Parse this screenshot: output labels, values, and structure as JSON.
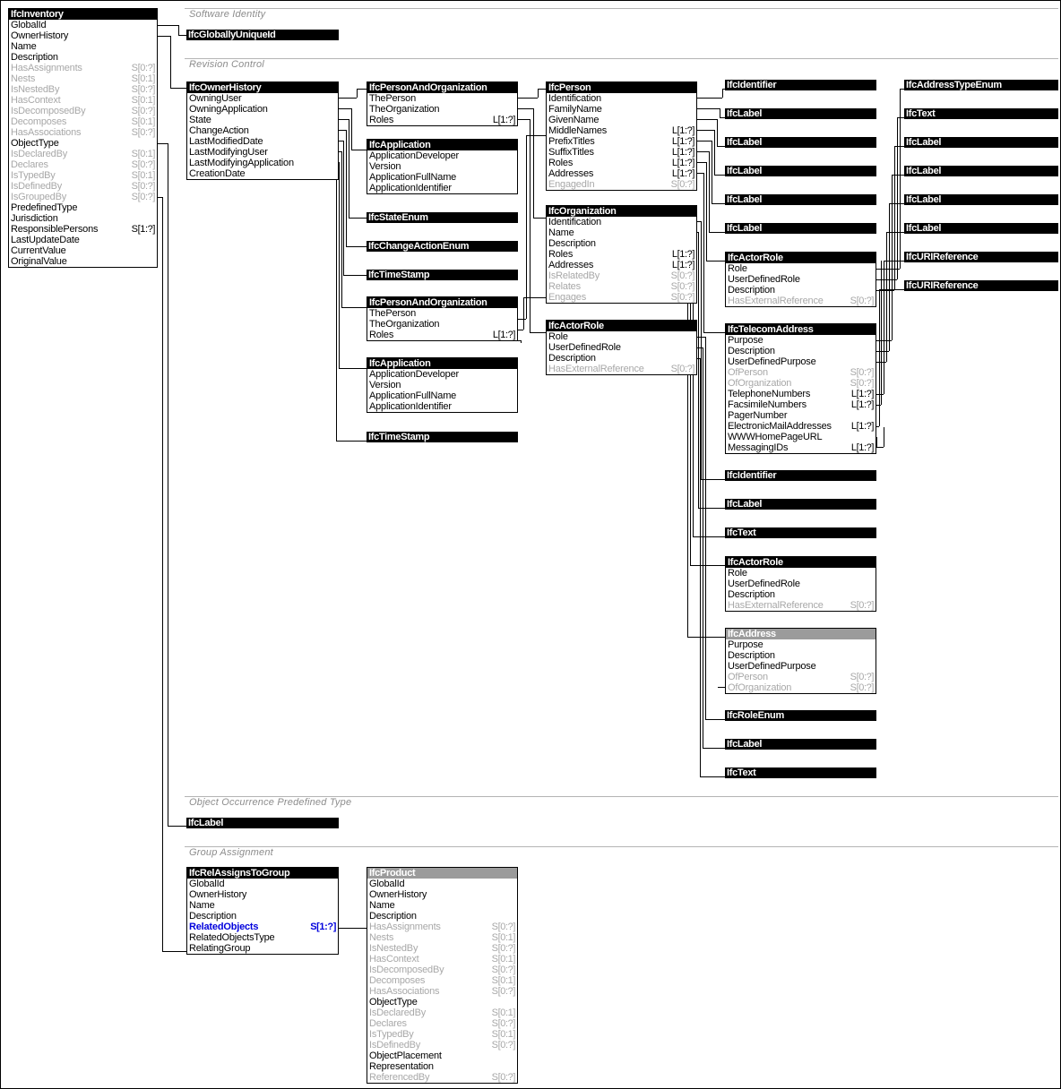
{
  "diagram": {
    "title": "IfcInventory entity relationship diagram",
    "sections": [
      {
        "id": "software-identity",
        "label": "Software Identity"
      },
      {
        "id": "revision-control",
        "label": "Revision Control"
      },
      {
        "id": "object-occurrence-predefined-type",
        "label": "Object Occurrence Predefined Type"
      },
      {
        "id": "group-assignment",
        "label": "Group Assignment"
      }
    ],
    "colors": {
      "header_concrete": "#000000",
      "header_abstract": "#9b9b9b",
      "attribute_text": "#000000",
      "inverse_text": "#a8a8a8",
      "highlight_text": "#0000dd",
      "section_text": "#8c8c8c",
      "canvas": "#ffffff"
    }
  },
  "entities": {
    "ifc_inventory": {
      "name": "IfcInventory",
      "abstract": false,
      "attributes": [
        {
          "name": "GlobalId",
          "card": "",
          "kind": "direct"
        },
        {
          "name": "OwnerHistory",
          "card": "",
          "kind": "direct"
        },
        {
          "name": "Name",
          "card": "",
          "kind": "direct"
        },
        {
          "name": "Description",
          "card": "",
          "kind": "direct"
        },
        {
          "name": "HasAssignments",
          "card": "S[0:?]",
          "kind": "inverse"
        },
        {
          "name": "Nests",
          "card": "S[0:1]",
          "kind": "inverse"
        },
        {
          "name": "IsNestedBy",
          "card": "S[0:?]",
          "kind": "inverse"
        },
        {
          "name": "HasContext",
          "card": "S[0:1]",
          "kind": "inverse"
        },
        {
          "name": "IsDecomposedBy",
          "card": "S[0:?]",
          "kind": "inverse"
        },
        {
          "name": "Decomposes",
          "card": "S[0:1]",
          "kind": "inverse"
        },
        {
          "name": "HasAssociations",
          "card": "S[0:?]",
          "kind": "inverse"
        },
        {
          "name": "ObjectType",
          "card": "",
          "kind": "direct"
        },
        {
          "name": "IsDeclaredBy",
          "card": "S[0:1]",
          "kind": "inverse"
        },
        {
          "name": "Declares",
          "card": "S[0:?]",
          "kind": "inverse"
        },
        {
          "name": "IsTypedBy",
          "card": "S[0:1]",
          "kind": "inverse"
        },
        {
          "name": "IsDefinedBy",
          "card": "S[0:?]",
          "kind": "inverse"
        },
        {
          "name": "IsGroupedBy",
          "card": "S[0:?]",
          "kind": "inverse"
        },
        {
          "name": "PredefinedType",
          "card": "",
          "kind": "direct"
        },
        {
          "name": "Jurisdiction",
          "card": "",
          "kind": "direct"
        },
        {
          "name": "ResponsiblePersons",
          "card": "S[1:?]",
          "kind": "direct"
        },
        {
          "name": "LastUpdateDate",
          "card": "",
          "kind": "direct"
        },
        {
          "name": "CurrentValue",
          "card": "",
          "kind": "direct"
        },
        {
          "name": "OriginalValue",
          "card": "",
          "kind": "direct"
        }
      ]
    },
    "ifc_owner_history": {
      "name": "IfcOwnerHistory",
      "abstract": false,
      "attributes": [
        {
          "name": "OwningUser",
          "card": "",
          "kind": "direct"
        },
        {
          "name": "OwningApplication",
          "card": "",
          "kind": "direct"
        },
        {
          "name": "State",
          "card": "",
          "kind": "direct"
        },
        {
          "name": "ChangeAction",
          "card": "",
          "kind": "direct"
        },
        {
          "name": "LastModifiedDate",
          "card": "",
          "kind": "direct"
        },
        {
          "name": "LastModifyingUser",
          "card": "",
          "kind": "direct"
        },
        {
          "name": "LastModifyingApplication",
          "card": "",
          "kind": "direct"
        },
        {
          "name": "CreationDate",
          "card": "",
          "kind": "direct"
        }
      ]
    },
    "ifc_person_and_organization_1": {
      "name": "IfcPersonAndOrganization",
      "abstract": false,
      "attributes": [
        {
          "name": "ThePerson",
          "card": "",
          "kind": "direct"
        },
        {
          "name": "TheOrganization",
          "card": "",
          "kind": "direct"
        },
        {
          "name": "Roles",
          "card": "L[1:?]",
          "kind": "direct"
        }
      ]
    },
    "ifc_application_1": {
      "name": "IfcApplication",
      "abstract": false,
      "attributes": [
        {
          "name": "ApplicationDeveloper",
          "card": "",
          "kind": "direct"
        },
        {
          "name": "Version",
          "card": "",
          "kind": "direct"
        },
        {
          "name": "ApplicationFullName",
          "card": "",
          "kind": "direct"
        },
        {
          "name": "ApplicationIdentifier",
          "card": "",
          "kind": "direct"
        }
      ]
    },
    "ifc_person_and_organization_2": {
      "name": "IfcPersonAndOrganization",
      "abstract": false,
      "attributes": [
        {
          "name": "ThePerson",
          "card": "",
          "kind": "direct"
        },
        {
          "name": "TheOrganization",
          "card": "",
          "kind": "direct"
        },
        {
          "name": "Roles",
          "card": "L[1:?]",
          "kind": "direct"
        }
      ]
    },
    "ifc_application_2": {
      "name": "IfcApplication",
      "abstract": false,
      "attributes": [
        {
          "name": "ApplicationDeveloper",
          "card": "",
          "kind": "direct"
        },
        {
          "name": "Version",
          "card": "",
          "kind": "direct"
        },
        {
          "name": "ApplicationFullName",
          "card": "",
          "kind": "direct"
        },
        {
          "name": "ApplicationIdentifier",
          "card": "",
          "kind": "direct"
        }
      ]
    },
    "ifc_person": {
      "name": "IfcPerson",
      "abstract": false,
      "attributes": [
        {
          "name": "Identification",
          "card": "",
          "kind": "direct"
        },
        {
          "name": "FamilyName",
          "card": "",
          "kind": "direct"
        },
        {
          "name": "GivenName",
          "card": "",
          "kind": "direct"
        },
        {
          "name": "MiddleNames",
          "card": "L[1:?]",
          "kind": "direct"
        },
        {
          "name": "PrefixTitles",
          "card": "L[1:?]",
          "kind": "direct"
        },
        {
          "name": "SuffixTitles",
          "card": "L[1:?]",
          "kind": "direct"
        },
        {
          "name": "Roles",
          "card": "L[1:?]",
          "kind": "direct"
        },
        {
          "name": "Addresses",
          "card": "L[1:?]",
          "kind": "direct"
        },
        {
          "name": "EngagedIn",
          "card": "S[0:?]",
          "kind": "inverse"
        }
      ]
    },
    "ifc_organization": {
      "name": "IfcOrganization",
      "abstract": false,
      "attributes": [
        {
          "name": "Identification",
          "card": "",
          "kind": "direct"
        },
        {
          "name": "Name",
          "card": "",
          "kind": "direct"
        },
        {
          "name": "Description",
          "card": "",
          "kind": "direct"
        },
        {
          "name": "Roles",
          "card": "L[1:?]",
          "kind": "direct"
        },
        {
          "name": "Addresses",
          "card": "L[1:?]",
          "kind": "direct"
        },
        {
          "name": "IsRelatedBy",
          "card": "S[0:?]",
          "kind": "inverse"
        },
        {
          "name": "Relates",
          "card": "S[0:?]",
          "kind": "inverse"
        },
        {
          "name": "Engages",
          "card": "S[0:?]",
          "kind": "inverse"
        }
      ]
    },
    "ifc_actor_role_mid": {
      "name": "IfcActorRole",
      "abstract": false,
      "attributes": [
        {
          "name": "Role",
          "card": "",
          "kind": "direct"
        },
        {
          "name": "UserDefinedRole",
          "card": "",
          "kind": "direct"
        },
        {
          "name": "Description",
          "card": "",
          "kind": "direct"
        },
        {
          "name": "HasExternalReference",
          "card": "S[0:?]",
          "kind": "inverse"
        }
      ]
    },
    "ifc_actor_role_r1": {
      "name": "IfcActorRole",
      "abstract": false,
      "attributes": [
        {
          "name": "Role",
          "card": "",
          "kind": "direct"
        },
        {
          "name": "UserDefinedRole",
          "card": "",
          "kind": "direct"
        },
        {
          "name": "Description",
          "card": "",
          "kind": "direct"
        },
        {
          "name": "HasExternalReference",
          "card": "S[0:?]",
          "kind": "inverse"
        }
      ]
    },
    "ifc_telecom_address": {
      "name": "IfcTelecomAddress",
      "abstract": false,
      "attributes": [
        {
          "name": "Purpose",
          "card": "",
          "kind": "direct"
        },
        {
          "name": "Description",
          "card": "",
          "kind": "direct"
        },
        {
          "name": "UserDefinedPurpose",
          "card": "",
          "kind": "direct"
        },
        {
          "name": "OfPerson",
          "card": "S[0:?]",
          "kind": "inverse"
        },
        {
          "name": "OfOrganization",
          "card": "S[0:?]",
          "kind": "inverse"
        },
        {
          "name": "TelephoneNumbers",
          "card": "L[1:?]",
          "kind": "direct"
        },
        {
          "name": "FacsimileNumbers",
          "card": "L[1:?]",
          "kind": "direct"
        },
        {
          "name": "PagerNumber",
          "card": "",
          "kind": "direct"
        },
        {
          "name": "ElectronicMailAddresses",
          "card": "L[1:?]",
          "kind": "direct"
        },
        {
          "name": "WWWHomePageURL",
          "card": "",
          "kind": "direct"
        },
        {
          "name": "MessagingIDs",
          "card": "L[1:?]",
          "kind": "direct"
        }
      ]
    },
    "ifc_actor_role_r2": {
      "name": "IfcActorRole",
      "abstract": false,
      "attributes": [
        {
          "name": "Role",
          "card": "",
          "kind": "direct"
        },
        {
          "name": "UserDefinedRole",
          "card": "",
          "kind": "direct"
        },
        {
          "name": "Description",
          "card": "",
          "kind": "direct"
        },
        {
          "name": "HasExternalReference",
          "card": "S[0:?]",
          "kind": "inverse"
        }
      ]
    },
    "ifc_address": {
      "name": "IfcAddress",
      "abstract": true,
      "attributes": [
        {
          "name": "Purpose",
          "card": "",
          "kind": "direct"
        },
        {
          "name": "Description",
          "card": "",
          "kind": "direct"
        },
        {
          "name": "UserDefinedPurpose",
          "card": "",
          "kind": "direct"
        },
        {
          "name": "OfPerson",
          "card": "S[0:?]",
          "kind": "inverse"
        },
        {
          "name": "OfOrganization",
          "card": "S[0:?]",
          "kind": "inverse"
        }
      ]
    },
    "ifc_rel_assigns_to_group": {
      "name": "IfcRelAssignsToGroup",
      "abstract": false,
      "attributes": [
        {
          "name": "GlobalId",
          "card": "",
          "kind": "direct"
        },
        {
          "name": "OwnerHistory",
          "card": "",
          "kind": "direct"
        },
        {
          "name": "Name",
          "card": "",
          "kind": "direct"
        },
        {
          "name": "Description",
          "card": "",
          "kind": "direct"
        },
        {
          "name": "RelatedObjects",
          "card": "S[1:?]",
          "kind": "highlight"
        },
        {
          "name": "RelatedObjectsType",
          "card": "",
          "kind": "direct"
        },
        {
          "name": "RelatingGroup",
          "card": "",
          "kind": "direct"
        }
      ]
    },
    "ifc_product": {
      "name": "IfcProduct",
      "abstract": true,
      "attributes": [
        {
          "name": "GlobalId",
          "card": "",
          "kind": "direct"
        },
        {
          "name": "OwnerHistory",
          "card": "",
          "kind": "direct"
        },
        {
          "name": "Name",
          "card": "",
          "kind": "direct"
        },
        {
          "name": "Description",
          "card": "",
          "kind": "direct"
        },
        {
          "name": "HasAssignments",
          "card": "S[0:?]",
          "kind": "inverse"
        },
        {
          "name": "Nests",
          "card": "S[0:1]",
          "kind": "inverse"
        },
        {
          "name": "IsNestedBy",
          "card": "S[0:?]",
          "kind": "inverse"
        },
        {
          "name": "HasContext",
          "card": "S[0:1]",
          "kind": "inverse"
        },
        {
          "name": "IsDecomposedBy",
          "card": "S[0:?]",
          "kind": "inverse"
        },
        {
          "name": "Decomposes",
          "card": "S[0:1]",
          "kind": "inverse"
        },
        {
          "name": "HasAssociations",
          "card": "S[0:?]",
          "kind": "inverse"
        },
        {
          "name": "ObjectType",
          "card": "",
          "kind": "direct"
        },
        {
          "name": "IsDeclaredBy",
          "card": "S[0:1]",
          "kind": "inverse"
        },
        {
          "name": "Declares",
          "card": "S[0:?]",
          "kind": "inverse"
        },
        {
          "name": "IsTypedBy",
          "card": "S[0:1]",
          "kind": "inverse"
        },
        {
          "name": "IsDefinedBy",
          "card": "S[0:?]",
          "kind": "inverse"
        },
        {
          "name": "ObjectPlacement",
          "card": "",
          "kind": "direct"
        },
        {
          "name": "Representation",
          "card": "",
          "kind": "direct"
        },
        {
          "name": "ReferencedBy",
          "card": "S[0:?]",
          "kind": "inverse"
        }
      ]
    }
  },
  "types": {
    "t_guid": {
      "name": "IfcGloballyUniqueId"
    },
    "t_state_enum": {
      "name": "IfcStateEnum"
    },
    "t_change_enum": {
      "name": "IfcChangeActionEnum"
    },
    "t_timestamp_1": {
      "name": "IfcTimeStamp"
    },
    "t_timestamp_2": {
      "name": "IfcTimeStamp"
    },
    "t_identifier_1": {
      "name": "IfcIdentifier"
    },
    "t_label_1": {
      "name": "IfcLabel"
    },
    "t_label_2": {
      "name": "IfcLabel"
    },
    "t_label_3": {
      "name": "IfcLabel"
    },
    "t_label_4": {
      "name": "IfcLabel"
    },
    "t_label_5": {
      "name": "IfcLabel"
    },
    "t_identifier_2": {
      "name": "IfcIdentifier"
    },
    "t_label_6": {
      "name": "IfcLabel"
    },
    "t_text_1": {
      "name": "IfcText"
    },
    "t_role_enum": {
      "name": "IfcRoleEnum"
    },
    "t_label_7": {
      "name": "IfcLabel"
    },
    "t_text_2": {
      "name": "IfcText"
    },
    "t_addr_enum": {
      "name": "IfcAddressTypeEnum"
    },
    "t_text_3": {
      "name": "IfcText"
    },
    "t_label_r1": {
      "name": "IfcLabel"
    },
    "t_label_r2": {
      "name": "IfcLabel"
    },
    "t_label_r3": {
      "name": "IfcLabel"
    },
    "t_label_r4": {
      "name": "IfcLabel"
    },
    "t_uri_1": {
      "name": "IfcURIReference"
    },
    "t_uri_2": {
      "name": "IfcURIReference"
    },
    "t_label_obj": {
      "name": "IfcLabel"
    }
  }
}
